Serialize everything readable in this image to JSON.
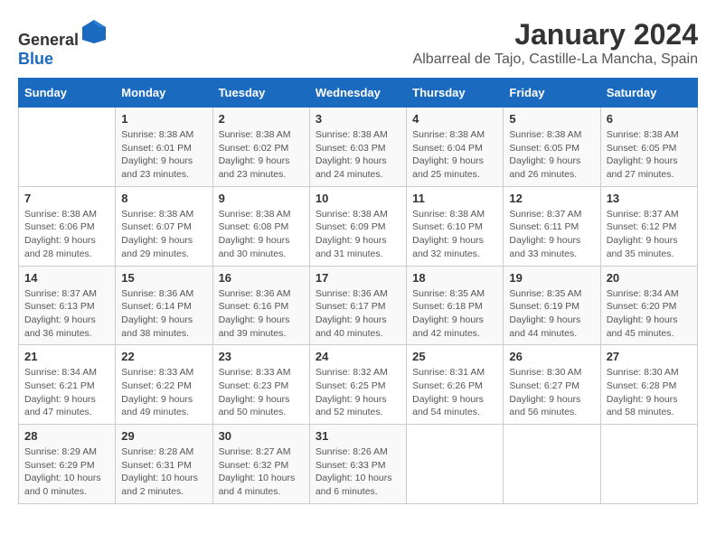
{
  "logo": {
    "general": "General",
    "blue": "Blue"
  },
  "title": {
    "month": "January 2024",
    "location": "Albarreal de Tajo, Castille-La Mancha, Spain"
  },
  "headers": [
    "Sunday",
    "Monday",
    "Tuesday",
    "Wednesday",
    "Thursday",
    "Friday",
    "Saturday"
  ],
  "weeks": [
    [
      {
        "day": "",
        "info": ""
      },
      {
        "day": "1",
        "info": "Sunrise: 8:38 AM\nSunset: 6:01 PM\nDaylight: 9 hours and 23 minutes."
      },
      {
        "day": "2",
        "info": "Sunrise: 8:38 AM\nSunset: 6:02 PM\nDaylight: 9 hours and 23 minutes."
      },
      {
        "day": "3",
        "info": "Sunrise: 8:38 AM\nSunset: 6:03 PM\nDaylight: 9 hours and 24 minutes."
      },
      {
        "day": "4",
        "info": "Sunrise: 8:38 AM\nSunset: 6:04 PM\nDaylight: 9 hours and 25 minutes."
      },
      {
        "day": "5",
        "info": "Sunrise: 8:38 AM\nSunset: 6:05 PM\nDaylight: 9 hours and 26 minutes."
      },
      {
        "day": "6",
        "info": "Sunrise: 8:38 AM\nSunset: 6:05 PM\nDaylight: 9 hours and 27 minutes."
      }
    ],
    [
      {
        "day": "7",
        "info": "Sunrise: 8:38 AM\nSunset: 6:06 PM\nDaylight: 9 hours and 28 minutes."
      },
      {
        "day": "8",
        "info": "Sunrise: 8:38 AM\nSunset: 6:07 PM\nDaylight: 9 hours and 29 minutes."
      },
      {
        "day": "9",
        "info": "Sunrise: 8:38 AM\nSunset: 6:08 PM\nDaylight: 9 hours and 30 minutes."
      },
      {
        "day": "10",
        "info": "Sunrise: 8:38 AM\nSunset: 6:09 PM\nDaylight: 9 hours and 31 minutes."
      },
      {
        "day": "11",
        "info": "Sunrise: 8:38 AM\nSunset: 6:10 PM\nDaylight: 9 hours and 32 minutes."
      },
      {
        "day": "12",
        "info": "Sunrise: 8:37 AM\nSunset: 6:11 PM\nDaylight: 9 hours and 33 minutes."
      },
      {
        "day": "13",
        "info": "Sunrise: 8:37 AM\nSunset: 6:12 PM\nDaylight: 9 hours and 35 minutes."
      }
    ],
    [
      {
        "day": "14",
        "info": "Sunrise: 8:37 AM\nSunset: 6:13 PM\nDaylight: 9 hours and 36 minutes."
      },
      {
        "day": "15",
        "info": "Sunrise: 8:36 AM\nSunset: 6:14 PM\nDaylight: 9 hours and 38 minutes."
      },
      {
        "day": "16",
        "info": "Sunrise: 8:36 AM\nSunset: 6:16 PM\nDaylight: 9 hours and 39 minutes."
      },
      {
        "day": "17",
        "info": "Sunrise: 8:36 AM\nSunset: 6:17 PM\nDaylight: 9 hours and 40 minutes."
      },
      {
        "day": "18",
        "info": "Sunrise: 8:35 AM\nSunset: 6:18 PM\nDaylight: 9 hours and 42 minutes."
      },
      {
        "day": "19",
        "info": "Sunrise: 8:35 AM\nSunset: 6:19 PM\nDaylight: 9 hours and 44 minutes."
      },
      {
        "day": "20",
        "info": "Sunrise: 8:34 AM\nSunset: 6:20 PM\nDaylight: 9 hours and 45 minutes."
      }
    ],
    [
      {
        "day": "21",
        "info": "Sunrise: 8:34 AM\nSunset: 6:21 PM\nDaylight: 9 hours and 47 minutes."
      },
      {
        "day": "22",
        "info": "Sunrise: 8:33 AM\nSunset: 6:22 PM\nDaylight: 9 hours and 49 minutes."
      },
      {
        "day": "23",
        "info": "Sunrise: 8:33 AM\nSunset: 6:23 PM\nDaylight: 9 hours and 50 minutes."
      },
      {
        "day": "24",
        "info": "Sunrise: 8:32 AM\nSunset: 6:25 PM\nDaylight: 9 hours and 52 minutes."
      },
      {
        "day": "25",
        "info": "Sunrise: 8:31 AM\nSunset: 6:26 PM\nDaylight: 9 hours and 54 minutes."
      },
      {
        "day": "26",
        "info": "Sunrise: 8:30 AM\nSunset: 6:27 PM\nDaylight: 9 hours and 56 minutes."
      },
      {
        "day": "27",
        "info": "Sunrise: 8:30 AM\nSunset: 6:28 PM\nDaylight: 9 hours and 58 minutes."
      }
    ],
    [
      {
        "day": "28",
        "info": "Sunrise: 8:29 AM\nSunset: 6:29 PM\nDaylight: 10 hours and 0 minutes."
      },
      {
        "day": "29",
        "info": "Sunrise: 8:28 AM\nSunset: 6:31 PM\nDaylight: 10 hours and 2 minutes."
      },
      {
        "day": "30",
        "info": "Sunrise: 8:27 AM\nSunset: 6:32 PM\nDaylight: 10 hours and 4 minutes."
      },
      {
        "day": "31",
        "info": "Sunrise: 8:26 AM\nSunset: 6:33 PM\nDaylight: 10 hours and 6 minutes."
      },
      {
        "day": "",
        "info": ""
      },
      {
        "day": "",
        "info": ""
      },
      {
        "day": "",
        "info": ""
      }
    ]
  ]
}
